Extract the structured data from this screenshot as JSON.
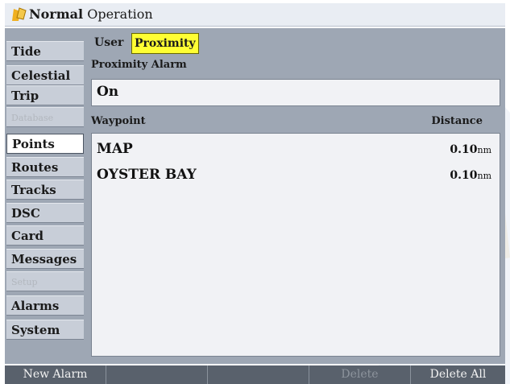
{
  "titlebar": {
    "mode": "Normal",
    "title": "Operation",
    "icon": "chartplotter-flag-icon"
  },
  "sidebar": {
    "items": [
      {
        "label": "Tide",
        "state": "normal"
      },
      {
        "label": "Celestial",
        "state": "normal"
      },
      {
        "label": "Trip",
        "state": "normal"
      },
      {
        "label": "Database",
        "state": "disabled"
      },
      {
        "label": "Points",
        "state": "selected"
      },
      {
        "label": "Routes",
        "state": "normal"
      },
      {
        "label": "Tracks",
        "state": "normal"
      },
      {
        "label": "DSC",
        "state": "normal"
      },
      {
        "label": "Card",
        "state": "normal"
      },
      {
        "label": "Messages",
        "state": "normal"
      },
      {
        "label": "Setup",
        "state": "disabled"
      },
      {
        "label": "Alarms",
        "state": "normal"
      },
      {
        "label": "System",
        "state": "normal"
      }
    ]
  },
  "main": {
    "tabs": [
      {
        "label": "User",
        "active": false
      },
      {
        "label": "Proximity",
        "active": true
      }
    ],
    "proximity_label": "Proximity Alarm",
    "alarm_value": "On",
    "columns": {
      "waypoint": "Waypoint",
      "distance": "Distance"
    },
    "rows": [
      {
        "name": "MAP",
        "distance": "0.10",
        "unit": "nm"
      },
      {
        "name": "OYSTER BAY",
        "distance": "0.10",
        "unit": "nm"
      }
    ]
  },
  "softkeys": [
    {
      "label": "New Alarm",
      "enabled": true
    },
    {
      "label": "",
      "enabled": false
    },
    {
      "label": "",
      "enabled": false
    },
    {
      "label": "Delete",
      "enabled": false
    },
    {
      "label": "Delete All",
      "enabled": true
    }
  ],
  "colors": {
    "tab_highlight": "#ffff33",
    "panel": "#9ea7b4",
    "softkey_bar": "#59616c"
  }
}
